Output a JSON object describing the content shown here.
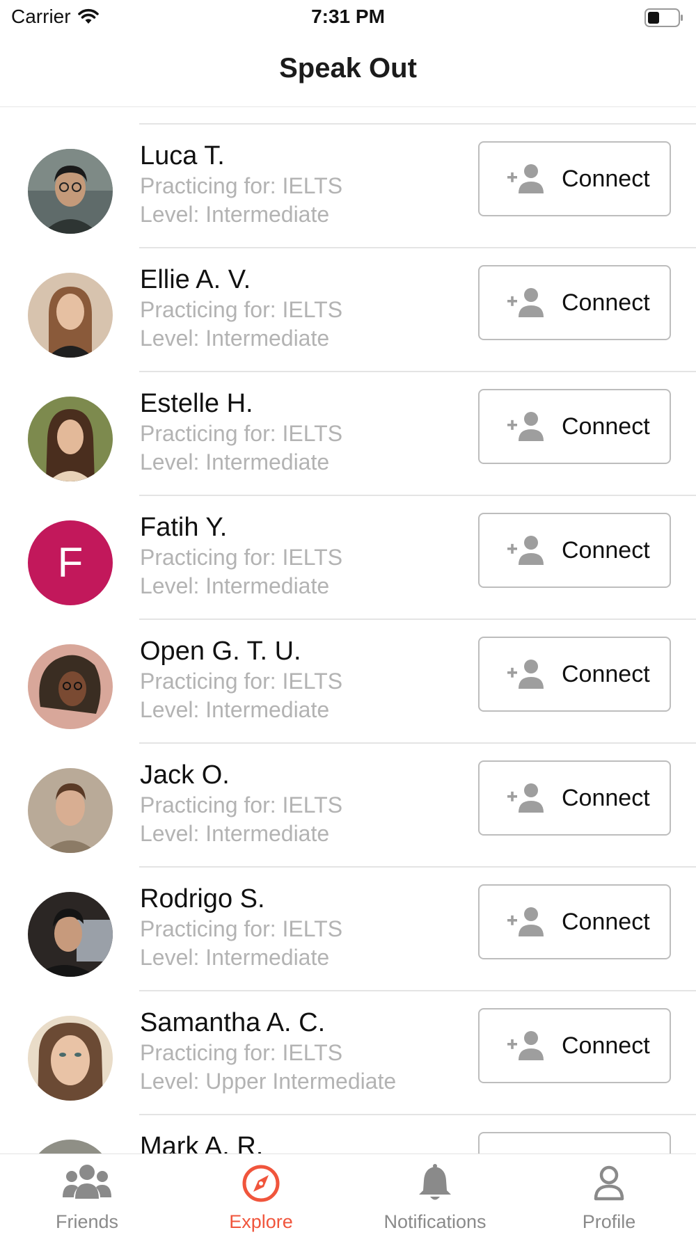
{
  "status_bar": {
    "carrier": "Carrier",
    "time": "7:31 PM"
  },
  "nav": {
    "title": "Speak Out"
  },
  "connect_label": "Connect",
  "users": [
    {
      "name": "Luca T.",
      "practicing": "Practicing for: IELTS",
      "level": "Level: Intermediate",
      "avatar": "photo"
    },
    {
      "name": "Ellie A. V.",
      "practicing": "Practicing for: IELTS",
      "level": "Level: Intermediate",
      "avatar": "photo"
    },
    {
      "name": "Estelle H.",
      "practicing": "Practicing for: IELTS",
      "level": "Level: Intermediate",
      "avatar": "photo"
    },
    {
      "name": "Fatih Y.",
      "practicing": "Practicing for: IELTS",
      "level": "Level: Intermediate",
      "avatar": "letter",
      "initial": "F",
      "color": "#c2185b"
    },
    {
      "name": "Open G. T. U.",
      "practicing": "Practicing for: IELTS",
      "level": "Level: Intermediate",
      "avatar": "photo"
    },
    {
      "name": "Jack O.",
      "practicing": "Practicing for: IELTS",
      "level": "Level: Intermediate",
      "avatar": "photo"
    },
    {
      "name": "Rodrigo S.",
      "practicing": "Practicing for: IELTS",
      "level": "Level: Intermediate",
      "avatar": "photo"
    },
    {
      "name": "Samantha A. C.",
      "practicing": "Practicing for: IELTS",
      "level": "Level: Upper Intermediate",
      "avatar": "photo"
    },
    {
      "name": "Mark A. R.",
      "practicing": "",
      "level": "",
      "avatar": "photo"
    }
  ],
  "tabs": [
    {
      "label": "Friends",
      "icon": "friends-icon",
      "active": false
    },
    {
      "label": "Explore",
      "icon": "compass-icon",
      "active": true
    },
    {
      "label": "Notifications",
      "icon": "bell-icon",
      "active": false
    },
    {
      "label": "Profile",
      "icon": "person-icon",
      "active": false
    }
  ],
  "colors": {
    "accent": "#f0553c",
    "inactive": "#8a8a8a",
    "secondary_text": "#b3b3b3"
  }
}
